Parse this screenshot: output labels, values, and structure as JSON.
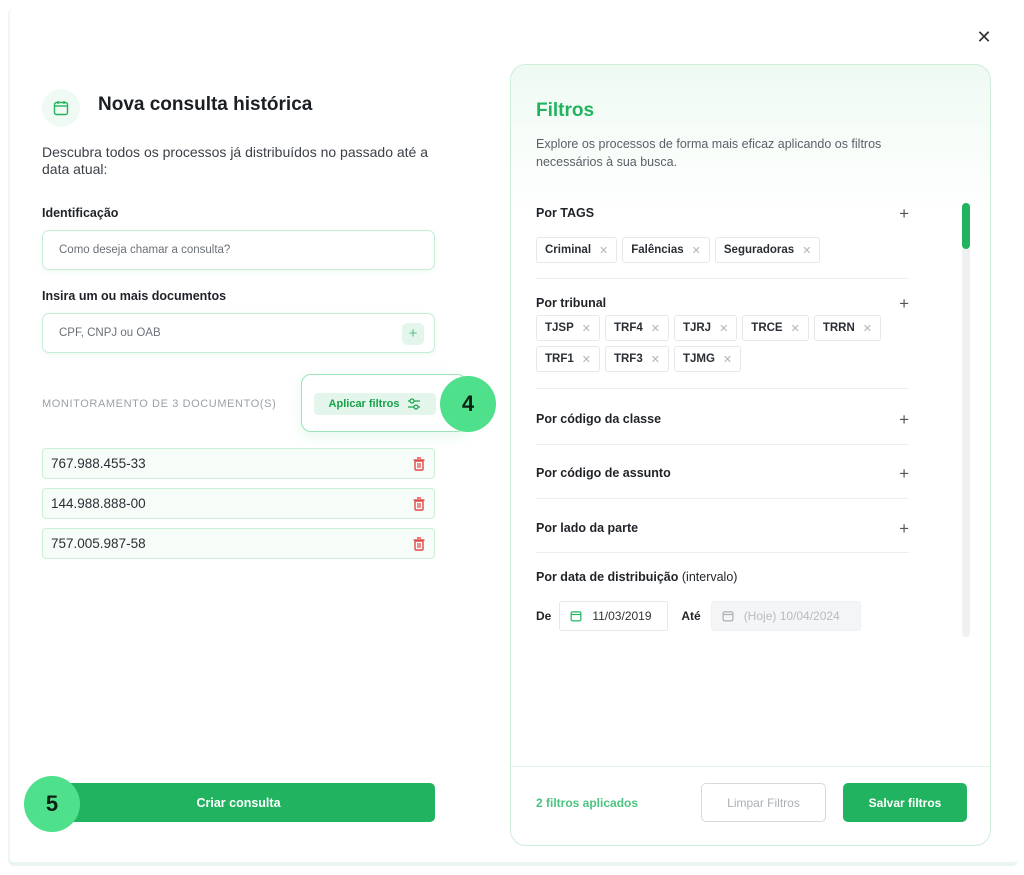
{
  "modal": {
    "close_icon": "✕"
  },
  "left": {
    "title": "Nova consulta histórica",
    "description": "Descubra todos os processos já distribuídos no passado até a data atual:",
    "identification_label": "Identificação",
    "identification_placeholder": "Como deseja chamar a consulta?",
    "documents_label": "Insira um ou mais documentos",
    "documents_placeholder": "CPF, CNPJ ou OAB",
    "monitoring_text": "MONITORAMENTO DE 3 DOCUMENTO(S)",
    "apply_filters_label": "Aplicar filtros",
    "documents": [
      "767.988.455-33",
      "144.988.888-00",
      "757.005.987-58"
    ],
    "create_button": "Criar consulta"
  },
  "badges": {
    "apply": "4",
    "create": "5"
  },
  "filters": {
    "title": "Filtros",
    "description": "Explore os processos de forma mais eficaz aplicando os filtros necessários à sua busca.",
    "sections": {
      "tags": {
        "title": "Por TAGS",
        "chips": [
          "Criminal",
          "Falências",
          "Seguradoras"
        ]
      },
      "tribunal": {
        "title": "Por tribunal",
        "chips": [
          "TJSP",
          "TRF4",
          "TJRJ",
          "TRCE",
          "TRRN",
          "TRF1",
          "TRF3",
          "TJMG"
        ]
      },
      "classe": {
        "title": "Por código da classe"
      },
      "assunto": {
        "title": "Por código de assunto"
      },
      "lado": {
        "title": "Por lado da parte"
      },
      "data": {
        "title": "Por data de distribuição",
        "title_suffix": "(intervalo)",
        "from_label": "De",
        "from_value": "11/03/2019",
        "to_label": "Até",
        "to_placeholder": "(Hoje) 10/04/2024"
      }
    },
    "footer": {
      "applied_text": "2 filtros aplicados",
      "clear_button": "Limpar Filtros",
      "save_button": "Salvar filtros"
    }
  },
  "colors": {
    "brand_green": "#21b35f",
    "badge_green": "#4ee08a",
    "danger_red": "#e04848"
  }
}
